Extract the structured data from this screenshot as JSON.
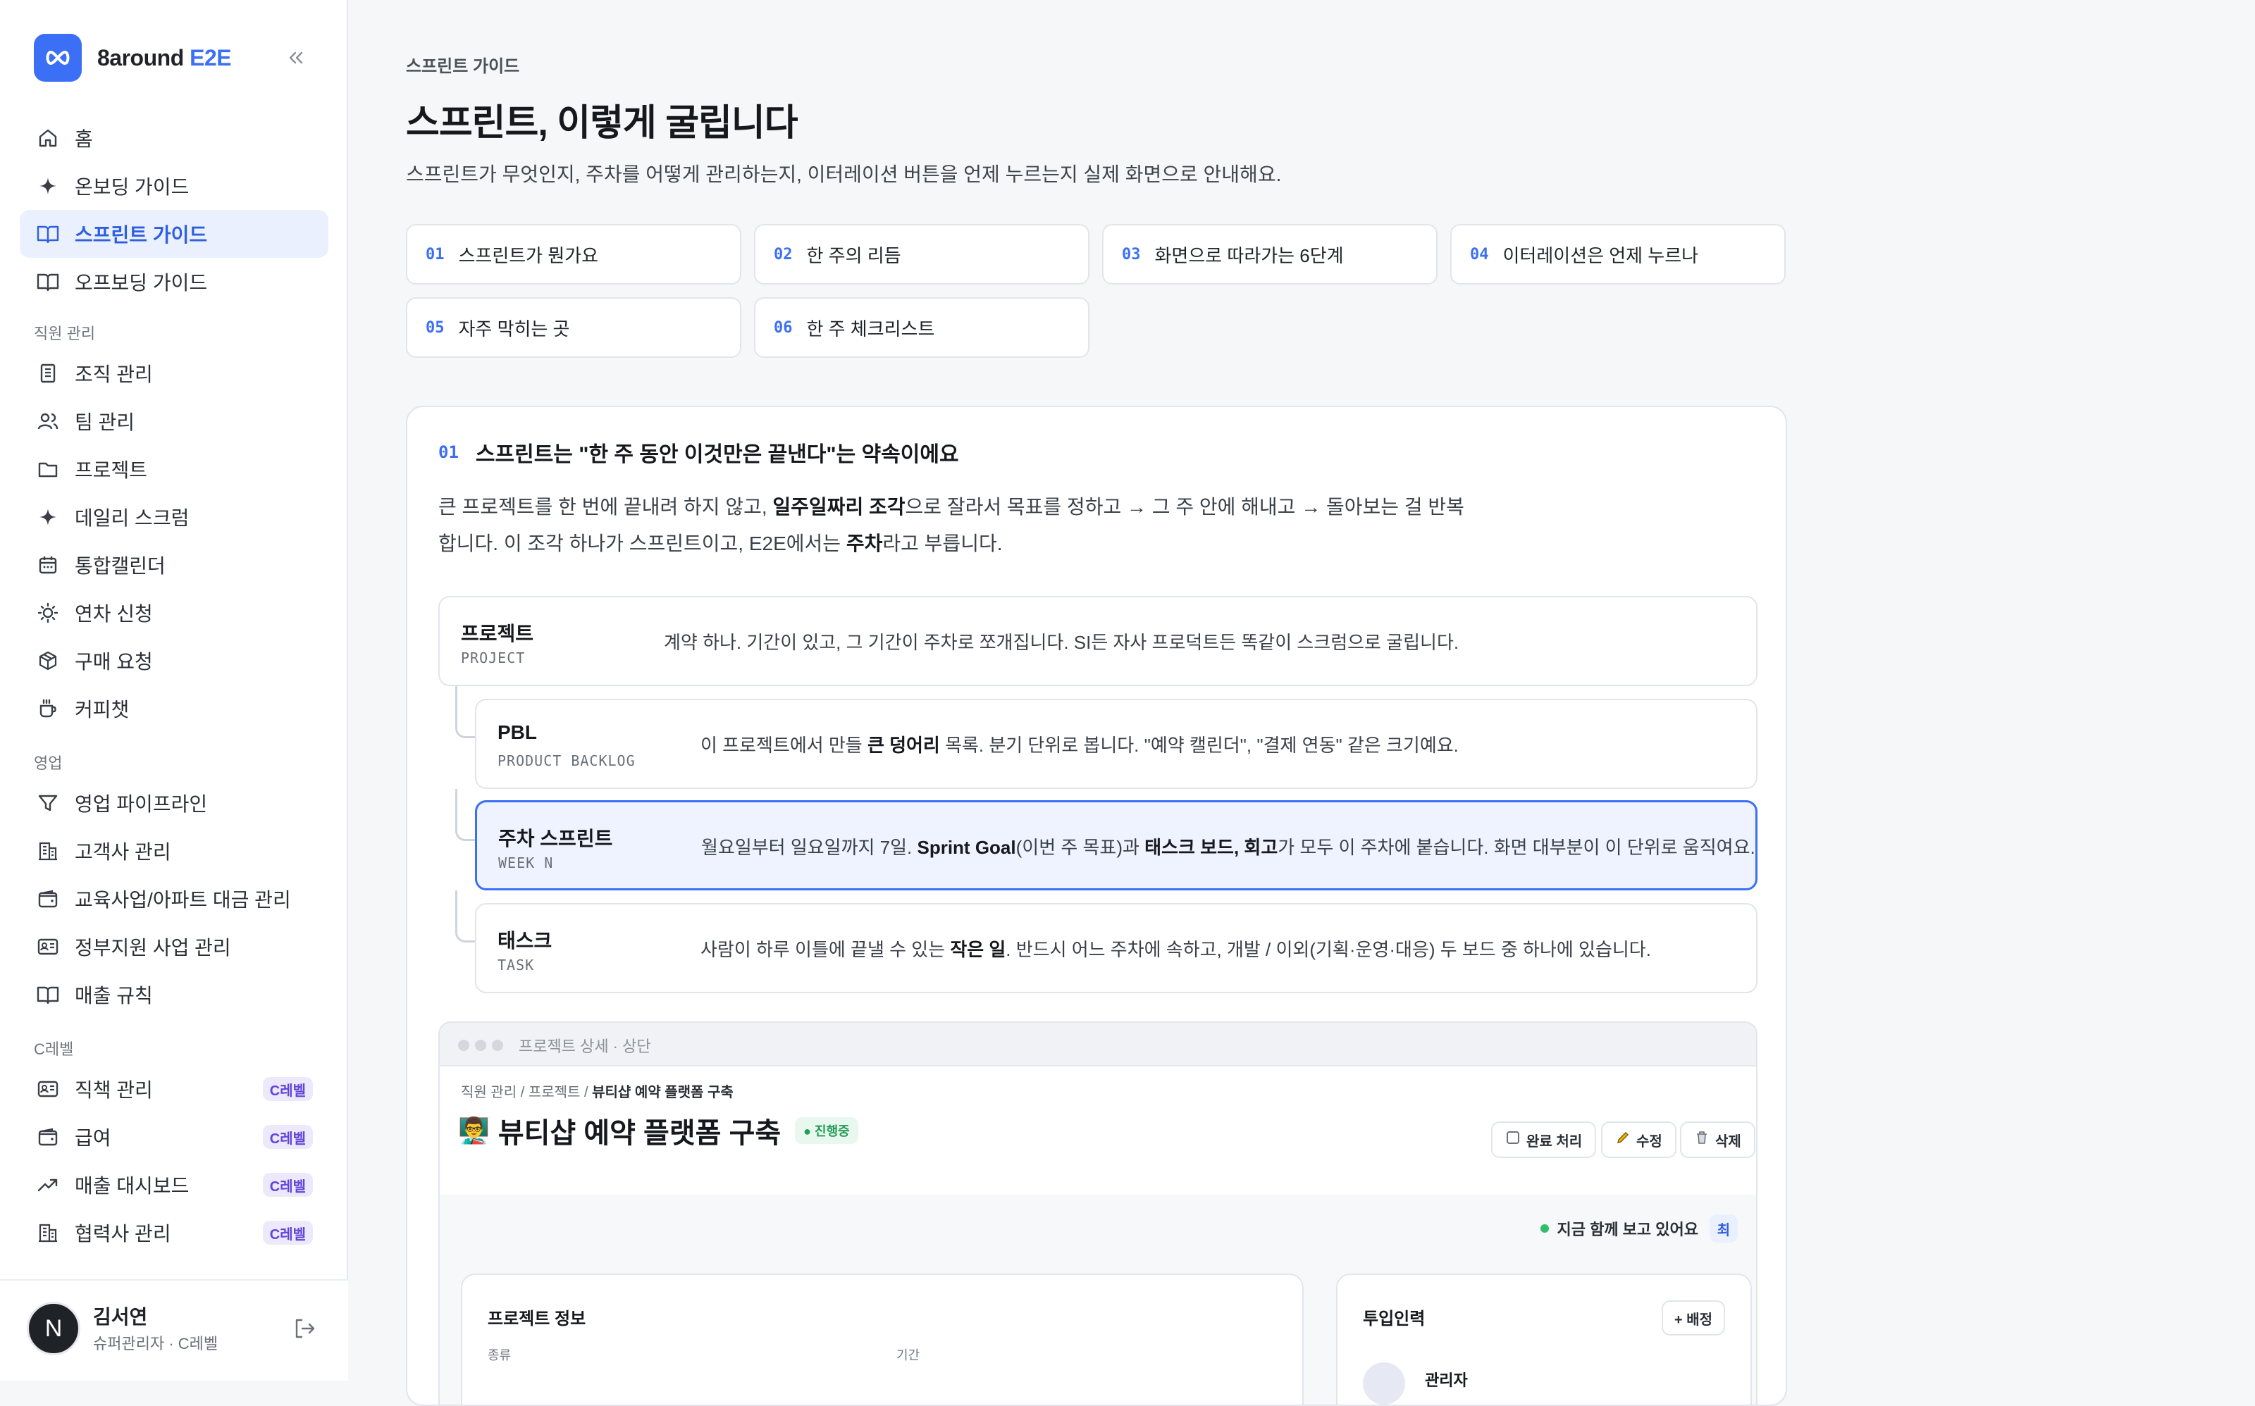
{
  "brand": {
    "name": "8around",
    "accent": "E2E"
  },
  "sidebar": {
    "top_items": [
      {
        "label": "홈",
        "icon": "home-icon"
      },
      {
        "label": "온보딩 가이드",
        "icon": "sparkle-icon"
      },
      {
        "label": "스프린트 가이드",
        "icon": "book-icon",
        "active": true
      },
      {
        "label": "오프보딩 가이드",
        "icon": "book-icon"
      }
    ],
    "sections": [
      {
        "title": "직원 관리",
        "items": [
          {
            "label": "조직 관리"
          },
          {
            "label": "팀 관리"
          },
          {
            "label": "프로젝트"
          },
          {
            "label": "데일리 스크럼"
          },
          {
            "label": "통합캘린더"
          },
          {
            "label": "연차 신청"
          },
          {
            "label": "구매 요청"
          },
          {
            "label": "커피챗"
          }
        ]
      },
      {
        "title": "영업",
        "items": [
          {
            "label": "영업 파이프라인"
          },
          {
            "label": "고객사 관리"
          },
          {
            "label": "교육사업/아파트 대금 관리"
          },
          {
            "label": "정부지원 사업 관리"
          },
          {
            "label": "매출 규칙"
          }
        ]
      },
      {
        "title": "C레벨",
        "items": [
          {
            "label": "직책 관리",
            "badge": "C레벨"
          },
          {
            "label": "급여",
            "badge": "C레벨"
          },
          {
            "label": "매출 대시보드",
            "badge": "C레벨"
          },
          {
            "label": "협력사 관리",
            "badge": "C레벨"
          }
        ]
      }
    ],
    "user": {
      "initial": "N",
      "name": "김서연",
      "role": "슈퍼관리자 · C레벨"
    }
  },
  "page": {
    "breadcrumb": "스프린트 가이드",
    "title": "스프린트, 이렇게 굴립니다",
    "subtitle": "스프린트가 무엇인지, 주차를 어떻게 관리하는지, 이터레이션 버튼을 언제 누르는지 실제 화면으로 안내해요."
  },
  "toc": [
    {
      "num": "01",
      "label": "스프린트가 뭔가요"
    },
    {
      "num": "02",
      "label": "한 주의 리듬"
    },
    {
      "num": "03",
      "label": "화면으로 따라가는 6단계"
    },
    {
      "num": "04",
      "label": "이터레이션은 언제 누르나"
    },
    {
      "num": "05",
      "label": "자주 막히는 곳"
    },
    {
      "num": "06",
      "label": "한 주 체크리스트"
    }
  ],
  "section1": {
    "num": "01",
    "title": "스프린트는 \"한 주 동안 이것만은 끝낸다\"는 약속이에요",
    "body": {
      "p1": "큰 프로젝트를 한 번에 끝내려 하지 않고, ",
      "b1": "일주일짜리 조각",
      "p2": "으로 잘라서 목표를 정하고 → 그 주 안에 해내고 → 돌아보는 걸 반복",
      "p3": "합니다. 이 조각 하나가 스프린트이고, E2E에서는 ",
      "b2": "주차",
      "p4": "라고 부릅니다."
    },
    "tiers": [
      {
        "name": "프로젝트",
        "code": "PROJECT",
        "desc": "계약 하나. 기간이 있고, 그 기간이 주차로 쪼개집니다. SI든 자사 프로덕트든 똑같이 스크럼으로 굴립니다."
      },
      {
        "name": "PBL",
        "code": "PRODUCT BACKLOG",
        "d1": "이 프로젝트에서 만들 ",
        "b1": "큰 덩어리",
        "d2": " 목록. 분기 단위로 봅니다. \"예약 캘린더\", \"결제 연동\" 같은 크기예요."
      },
      {
        "name": "주차 스프린트",
        "code": "WEEK N",
        "d1": "월요일부터 일요일까지 7일. ",
        "b1": "Sprint Goal",
        "d2": "(이번 주 목표)과 ",
        "b2": "태스크 보드, 회고",
        "d3": "가 모두 이 주차에 붙습니다. 화면 대부분이 이 단위로 움직여요."
      },
      {
        "name": "태스크",
        "code": "TASK",
        "d1": "사람이 하루 이틀에 끝낼 수 있는 ",
        "b1": "작은 일",
        "d2": ". 반드시 어느 주차에 속하고, 개발 / 이외(기획·운영·대응) 두 보드 중 하나에 있습니다."
      }
    ]
  },
  "mock": {
    "tag": "프로젝트 상세  ·  상단",
    "crumb_prefix": "직원 관리 / 프로젝트 / ",
    "crumb_current": "뷰티샵 예약 플랫폼 구축",
    "emoji": "👨‍🏫",
    "title": "뷰티샵 예약 플랫폼 구축",
    "status": "● 진행중",
    "buttons": {
      "complete": "완료 처리",
      "edit": "수정",
      "delete": "삭제"
    },
    "viewing": "지금 함께 보고 있어요",
    "viewing_chip": "최",
    "info_panel": {
      "title": "프로젝트 정보",
      "label_type": "종류",
      "label_period": "기간"
    },
    "staff_panel": {
      "title": "투입인력",
      "assign": "+ 배정",
      "member": "관리자"
    }
  },
  "colors": {
    "accent": "#3b6ff5",
    "active_bg": "#eaf0fe",
    "badge_bg": "#ece9fc",
    "badge_text": "#6045d8",
    "status_green": "#1f9d55"
  }
}
